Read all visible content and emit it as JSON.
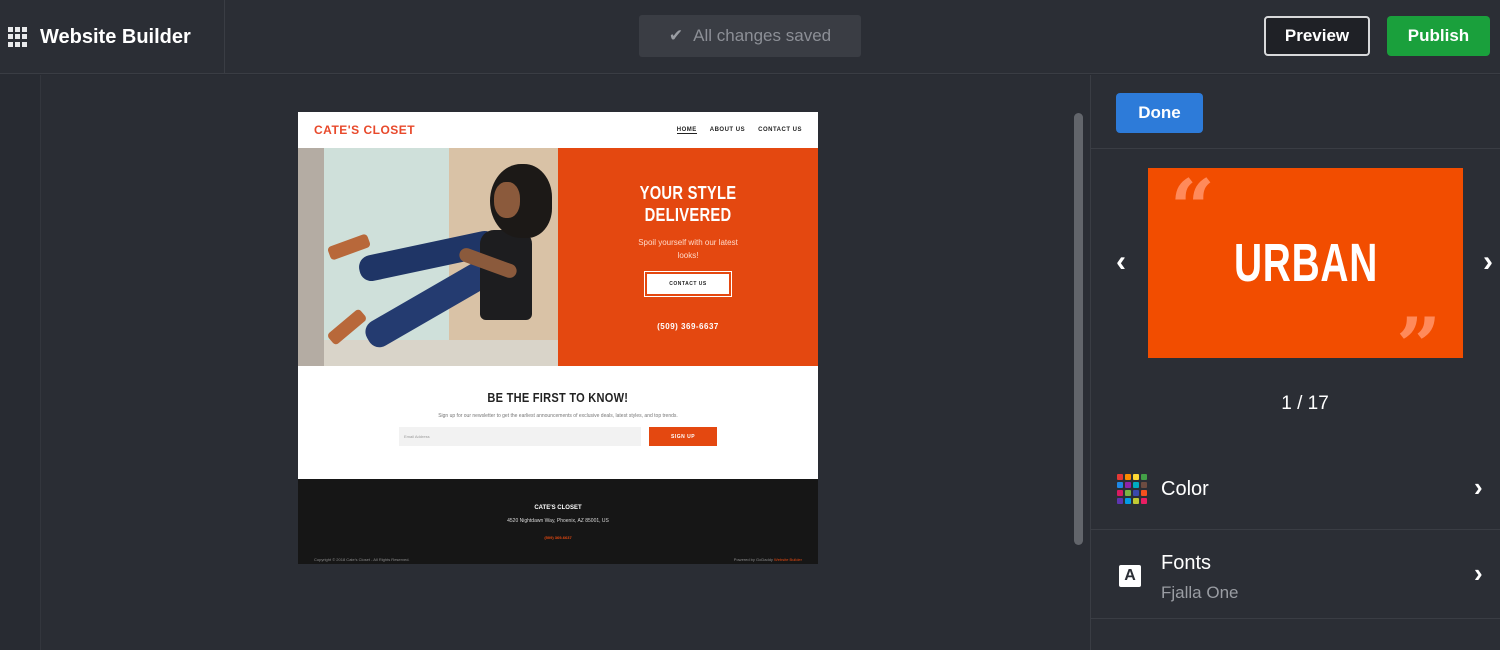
{
  "topbar": {
    "title": "Website Builder",
    "status": "All changes saved",
    "preview_label": "Preview",
    "publish_label": "Publish"
  },
  "site": {
    "logo": "CATE'S CLOSET",
    "nav": [
      "HOME",
      "ABOUT US",
      "CONTACT US"
    ],
    "hero": {
      "headline": "YOUR STYLE DELIVERED",
      "subtext": "Spoil yourself with our latest looks!",
      "button": "CONTACT US",
      "phone": "(509) 369-6637"
    },
    "newsletter": {
      "title": "BE THE FIRST TO KNOW!",
      "text": "Sign up for our newsletter to get the earliest announcements of exclusive deals, latest styles, and top trends.",
      "placeholder": "Email Address",
      "button": "SIGN UP"
    },
    "footer": {
      "name": "CATE'S CLOSET",
      "address": "4520 Nightdawn Way, Phoenix, AZ 85001, US",
      "phone": "(509) 369-6637",
      "copyright": "Copyright © 2018 Cate's Closet - All Rights Reserved.",
      "powered_prefix": "Powered by GoDaddy",
      "powered_link": "Website Builder"
    }
  },
  "panel": {
    "done_label": "Done",
    "theme_name": "URBAN",
    "counter": "1 / 17",
    "color_label": "Color",
    "fonts_label": "Fonts",
    "fonts_value": "Fjalla One"
  },
  "colors": {
    "accent_orange": "#f24d00",
    "publish_green": "#1aa03c",
    "done_blue": "#2d7bd9",
    "palette": [
      "#e53935",
      "#fb8c00",
      "#fdd835",
      "#43a047",
      "#1e88e5",
      "#8e24aa",
      "#00acc1",
      "#6d4c41",
      "#d81b60",
      "#7cb342",
      "#3949ab",
      "#f4511e",
      "#5e35b1",
      "#039be5",
      "#c0ca33",
      "#e91e63"
    ]
  },
  "icons": {
    "apps": "apps-grid-icon",
    "saved": "check-icon",
    "prev": "chevron-left-icon",
    "next": "chevron-right-icon",
    "color": "palette-icon",
    "fonts": "font-icon"
  }
}
